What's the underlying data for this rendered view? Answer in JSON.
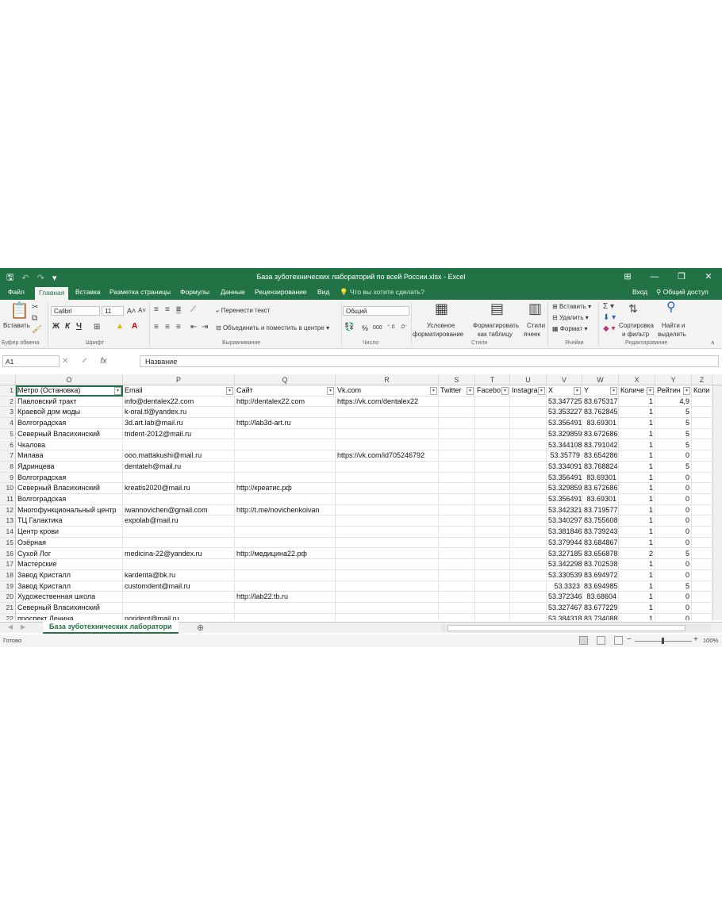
{
  "window": {
    "title": "База зуботехнических лабораторий по всей России.xlsx - Excel",
    "controls": {
      "ribbon_display": "⊞",
      "minimize": "—",
      "restore": "❐",
      "close": "✕"
    }
  },
  "qat": {
    "save": "🖫",
    "undo": "↶",
    "redo": "↷",
    "customize": "▾"
  },
  "tabs": [
    "Файл",
    "Главная",
    "Вставка",
    "Разметка страницы",
    "Формулы",
    "Данные",
    "Рецензирование",
    "Вид"
  ],
  "active_tab": "Главная",
  "tell_me": "Что вы хотите сделать?",
  "sign_in": "Вход",
  "share": "Общий доступ",
  "ribbon": {
    "clipboard": {
      "paste": "Вставить",
      "group": "Буфер обмена"
    },
    "font": {
      "name": "Calibri",
      "size": "11",
      "bold": "Ж",
      "italic": "К",
      "underline": "Ч",
      "grow": "A˄",
      "shrink": "A˅",
      "group": "Шрифт"
    },
    "alignment": {
      "wrap": "Перенести текст",
      "merge": "Объединить и поместить в центре",
      "group": "Выравнивание"
    },
    "number": {
      "format": "Общий",
      "percent": "%",
      "thousands": "000",
      "group": "Число"
    },
    "styles": {
      "conditional_1": "Условное",
      "conditional_2": "форматирование",
      "table_1": "Форматировать",
      "table_2": "как таблицу",
      "cell_1": "Стили",
      "cell_2": "ячеек",
      "group": "Стили"
    },
    "cells": {
      "insert": "Вставить",
      "delete": "Удалить",
      "format": "Формат",
      "group": "Ячейки"
    },
    "editing": {
      "sort_1": "Сортировка",
      "sort_2": "и фильтр",
      "find_1": "Найти и",
      "find_2": "выделить",
      "group": "Редактирование"
    }
  },
  "formula_bar": {
    "name_box": "A1",
    "fx": "fx",
    "content": "Название"
  },
  "columns": [
    "O",
    "P",
    "Q",
    "R",
    "S",
    "T",
    "U",
    "V",
    "W",
    "X",
    "Y",
    "Z"
  ],
  "headers": [
    "Метро (Остановка)",
    "Email",
    "Сайт",
    "Vk.com",
    "Twitter",
    "Facebo",
    "Instagra",
    "X",
    "Y",
    "Количе",
    "Рейтин",
    "Коли"
  ],
  "rows": [
    {
      "n": "1"
    },
    {
      "n": "2",
      "metro": "Павловский тракт",
      "email": "info@dentalex22.com",
      "site": "http://dentalex22.com",
      "vk": "https://vk.com/dentalex22",
      "x": "53.347725",
      "y": "83.675317",
      "count": "1",
      "rating": "4,9"
    },
    {
      "n": "3",
      "metro": "Краевой дом моды",
      "email": "k-oral.tl@yandex.ru",
      "site": "",
      "vk": "",
      "x": "53.353227",
      "y": "83.762845",
      "count": "1",
      "rating": "5"
    },
    {
      "n": "4",
      "metro": "Волгоградская",
      "email": "3d.art.lab@mail.ru",
      "site": "http://lab3d-art.ru",
      "vk": "",
      "x": "53.356491",
      "y": "83.69301",
      "count": "1",
      "rating": "5"
    },
    {
      "n": "5",
      "metro": "Северный Власихинский",
      "email": "trident-2012@mail.ru",
      "site": "",
      "vk": "",
      "x": "53.329859",
      "y": "83.672686",
      "count": "1",
      "rating": "5"
    },
    {
      "n": "6",
      "metro": "Чкалова",
      "email": "",
      "site": "",
      "vk": "",
      "x": "53.344108",
      "y": "83.791042",
      "count": "1",
      "rating": "5"
    },
    {
      "n": "7",
      "metro": "Милава",
      "email": "ooo.mattakushi@mail.ru",
      "site": "",
      "vk": "https://vk.com/id705246792",
      "x": "53.35779",
      "y": "83.654286",
      "count": "1",
      "rating": "0"
    },
    {
      "n": "8",
      "metro": "Ядринцева",
      "email": "dentateh@mail.ru",
      "site": "",
      "vk": "",
      "x": "53.334091",
      "y": "83.768824",
      "count": "1",
      "rating": "5"
    },
    {
      "n": "9",
      "metro": "Волгоградская",
      "email": "",
      "site": "",
      "vk": "",
      "x": "53.356491",
      "y": "83.69301",
      "count": "1",
      "rating": "0"
    },
    {
      "n": "10",
      "metro": "Северный Власихинский",
      "email": "kreatis2020@mail.ru",
      "site": "http://креатис.рф",
      "vk": "",
      "x": "53.329859",
      "y": "83.672686",
      "count": "1",
      "rating": "0"
    },
    {
      "n": "11",
      "metro": "Волгоградская",
      "email": "",
      "site": "",
      "vk": "",
      "x": "53.356491",
      "y": "83.69301",
      "count": "1",
      "rating": "0"
    },
    {
      "n": "12",
      "metro": "Многофункциональный центр",
      "email": "iwannovichen@gmail.com",
      "site": "http://t.me/novichenkoivan",
      "vk": "",
      "x": "53.342321",
      "y": "83.719577",
      "count": "1",
      "rating": "0"
    },
    {
      "n": "13",
      "metro": "ТЦ Галактика",
      "email": "expolab@mail.ru",
      "site": "",
      "vk": "",
      "x": "53.340297",
      "y": "83.755608",
      "count": "1",
      "rating": "0"
    },
    {
      "n": "14",
      "metro": "Центр крови",
      "email": "",
      "site": "",
      "vk": "",
      "x": "53.381846",
      "y": "83.739243",
      "count": "1",
      "rating": "0"
    },
    {
      "n": "15",
      "metro": "Озёрная",
      "email": "",
      "site": "",
      "vk": "",
      "x": "53.379944",
      "y": "83.684867",
      "count": "1",
      "rating": "0"
    },
    {
      "n": "16",
      "metro": "Сухой Лог",
      "email": "medicina-22@yandex.ru",
      "site": "http://медицина22.рф",
      "vk": "",
      "x": "53.327185",
      "y": "83.656878",
      "count": "2",
      "rating": "5"
    },
    {
      "n": "17",
      "metro": "Мастерские",
      "email": "",
      "site": "",
      "vk": "",
      "x": "53.342298",
      "y": "83.702538",
      "count": "1",
      "rating": "0"
    },
    {
      "n": "18",
      "metro": "Завод Кристалл",
      "email": "kardenta@bk.ru",
      "site": "",
      "vk": "",
      "x": "53.330539",
      "y": "83.694972",
      "count": "1",
      "rating": "0"
    },
    {
      "n": "19",
      "metro": "Завод Кристалл",
      "email": "customdent@mail.ru",
      "site": "",
      "vk": "",
      "x": "53.3323",
      "y": "83.694985",
      "count": "1",
      "rating": "5"
    },
    {
      "n": "20",
      "metro": "Художественная школа",
      "email": "",
      "site": "http://lab22.tb.ru",
      "vk": "",
      "x": "53.372346",
      "y": "83.68604",
      "count": "1",
      "rating": "0"
    },
    {
      "n": "21",
      "metro": "Северный Власихинский",
      "email": "",
      "site": "",
      "vk": "",
      "x": "53.327467",
      "y": "83.677229",
      "count": "1",
      "rating": "0"
    },
    {
      "n": "22",
      "metro": "проспект Ленина",
      "email": "norident@mail.ru",
      "site": "",
      "vk": "",
      "x": "53.384318",
      "y": "83.734088",
      "count": "1",
      "rating": "0"
    }
  ],
  "sheet_tab": "База зуботехнических лаборатори",
  "status": "Готово",
  "zoom": "100%"
}
